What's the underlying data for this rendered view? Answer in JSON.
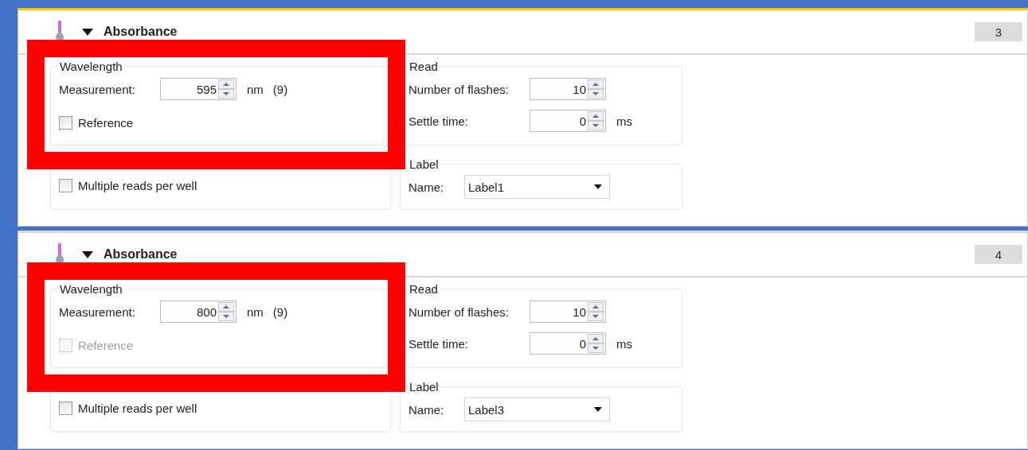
{
  "panels": [
    {
      "selected": true,
      "expanded": true,
      "highlighted": true,
      "title": "Absorbance",
      "number": "3",
      "wavelength": {
        "title": "Wavelength",
        "measurement_label": "Measurement:",
        "measurement_value": "595",
        "unit": "nm",
        "note": "(9)",
        "reference": {
          "label": "Reference",
          "checked": false,
          "disabled": false
        }
      },
      "multiple_reads": {
        "label": "Multiple reads per well",
        "checked": false
      },
      "read": {
        "title": "Read",
        "flashes_label": "Number of flashes:",
        "flashes_value": "10",
        "settle_label": "Settle time:",
        "settle_value": "0",
        "settle_unit": "ms"
      },
      "label": {
        "title": "Label",
        "name_label": "Name:",
        "name_value": "Label1"
      }
    },
    {
      "selected": false,
      "expanded": true,
      "highlighted": true,
      "title": "Absorbance",
      "number": "4",
      "wavelength": {
        "title": "Wavelength",
        "measurement_label": "Measurement:",
        "measurement_value": "800",
        "unit": "nm",
        "note": "(9)",
        "reference": {
          "label": "Reference",
          "checked": false,
          "disabled": true
        }
      },
      "multiple_reads": {
        "label": "Multiple reads per well",
        "checked": false
      },
      "read": {
        "title": "Read",
        "flashes_label": "Number of flashes:",
        "flashes_value": "10",
        "settle_label": "Settle time:",
        "settle_value": "0",
        "settle_unit": "ms"
      },
      "label": {
        "title": "Label",
        "name_label": "Name:",
        "name_value": "Label3"
      }
    }
  ]
}
